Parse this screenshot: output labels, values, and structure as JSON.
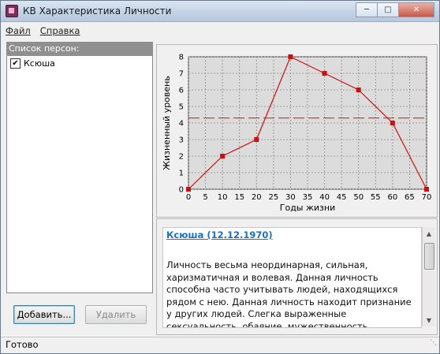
{
  "window": {
    "title": "КВ Характеристика Личности"
  },
  "menu": {
    "file": "Файл",
    "help": "Справка"
  },
  "sidebar": {
    "header": "Список персон:",
    "items": [
      {
        "label": "Ксюша",
        "checked": true
      }
    ],
    "add_button": "Добавить...",
    "delete_button": "Удалить"
  },
  "chart_data": {
    "type": "line",
    "x": [
      0,
      10,
      20,
      30,
      40,
      50,
      60,
      70
    ],
    "y": [
      0,
      2,
      3,
      8,
      7,
      6,
      4,
      0
    ],
    "xlabel": "Годы жизни",
    "ylabel": "Жизненный уровень",
    "xlim": [
      0,
      70
    ],
    "ylim": [
      0,
      8
    ],
    "xticks": [
      "0",
      "5",
      "10",
      "15",
      "20",
      "25",
      "30",
      "35",
      "40",
      "45",
      "50",
      "55",
      "60",
      "65",
      "70"
    ],
    "yticks": [
      "0",
      "1",
      "2",
      "3",
      "4",
      "5",
      "6",
      "7",
      "8"
    ],
    "reference_line": 4.3,
    "grid": true,
    "series_color": "#cc1010",
    "reference_color": "#d22a2a"
  },
  "details": {
    "person_title": "Ксюша (12.12.1970)",
    "description": "Личность весьма неординарная, сильная, харизматичная и волевая. Данная личность способна часто учитывать людей, находящихся рядом с нею. Данная личность находит признание у других людей. Слегка выраженные сексуальность, обаяние, мужественность (женственность). У данной личности есть талант, развиты интуиция и"
  },
  "status": {
    "text": "Готово"
  }
}
